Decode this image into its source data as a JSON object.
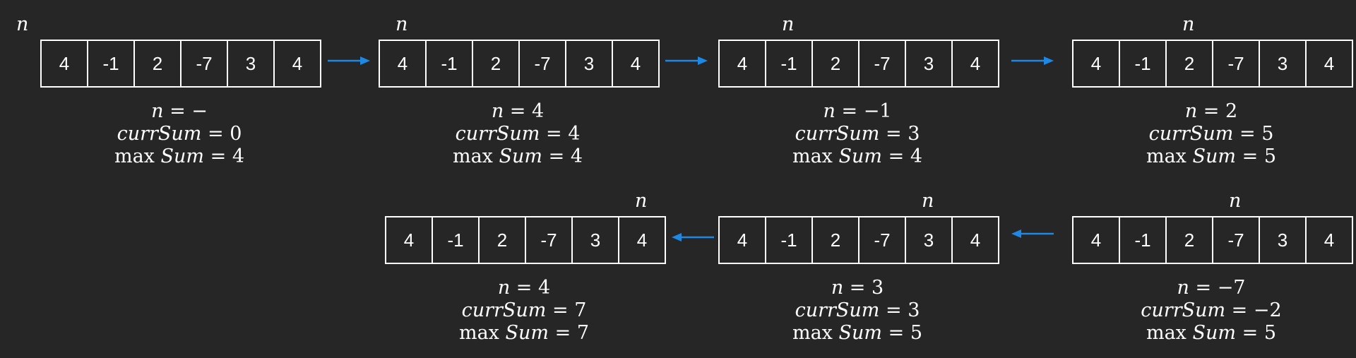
{
  "pointer_label": "n",
  "array": [
    "4",
    "-1",
    "2",
    "-7",
    "3",
    "4"
  ],
  "labels": {
    "n": "n",
    "currSum": "currSum",
    "max": "max",
    "sum": "Sum",
    "eq": " = "
  },
  "arrow_color": "#1e88e5",
  "steps": [
    {
      "n": "−",
      "currSum": "0",
      "maxSum": "4",
      "pointer_index": 0
    },
    {
      "n": "4",
      "currSum": "4",
      "maxSum": "4",
      "pointer_index": 0
    },
    {
      "n": "−1",
      "currSum": "3",
      "maxSum": "4",
      "pointer_index": 1
    },
    {
      "n": "2",
      "currSum": "5",
      "maxSum": "5",
      "pointer_index": 2
    },
    {
      "n": "−7",
      "currSum": "−2",
      "maxSum": "5",
      "pointer_index": 3
    },
    {
      "n": "3",
      "currSum": "3",
      "maxSum": "5",
      "pointer_index": 4
    },
    {
      "n": "4",
      "currSum": "7",
      "maxSum": "7",
      "pointer_index": 5
    }
  ]
}
